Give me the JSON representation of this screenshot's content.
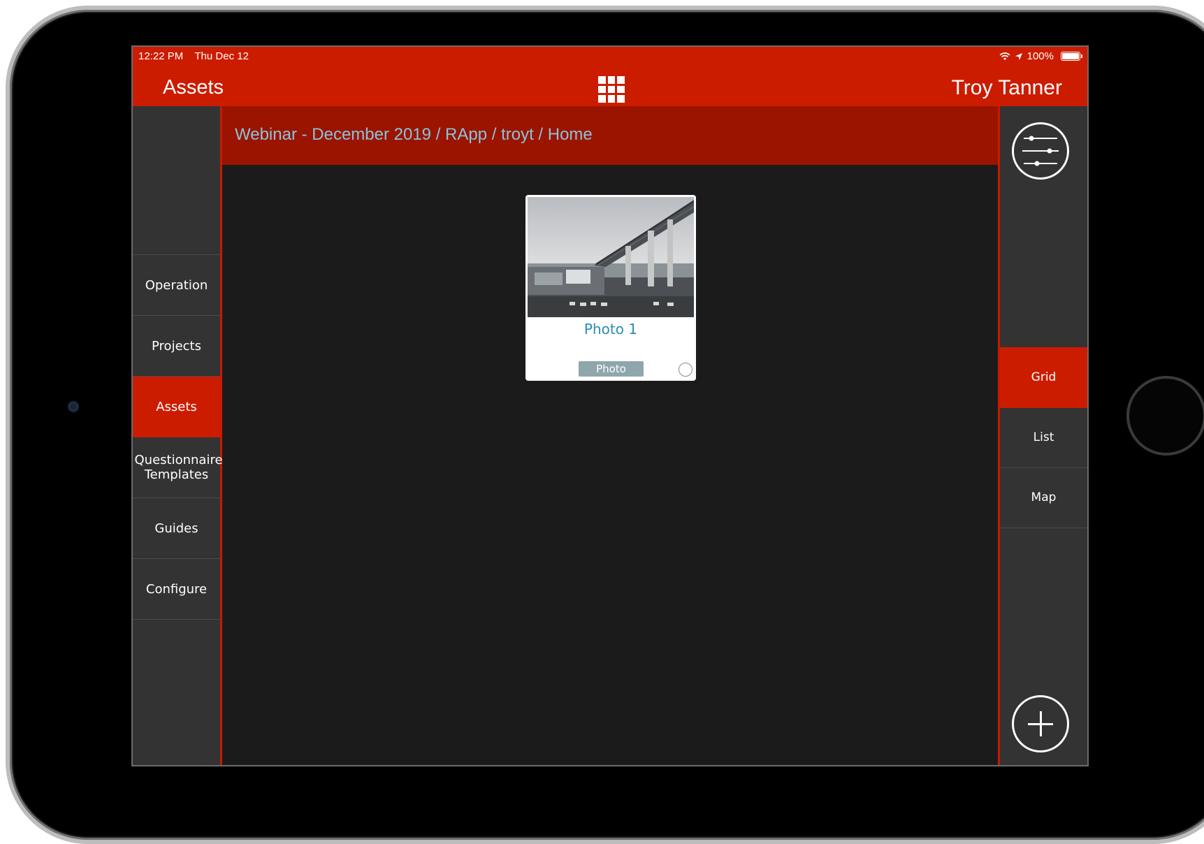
{
  "status_bar": {
    "time": "12:22 PM",
    "date": "Thu Dec 12",
    "battery": "100%",
    "icons": [
      "wifi-icon",
      "location-arrow-icon",
      "battery-icon"
    ]
  },
  "nav": {
    "title": "Assets",
    "center_icon": "grid-icon",
    "user": "Troy Tanner"
  },
  "breadcrumb": "Webinar - December 2019 / RApp / troyt / Home",
  "left_sidebar": {
    "items": [
      {
        "label": "Operation",
        "active": false
      },
      {
        "label": "Projects",
        "active": false
      },
      {
        "label": "Assets",
        "active": true
      },
      {
        "label": "Questionnaire Templates",
        "active": false
      },
      {
        "label": "Guides",
        "active": false
      },
      {
        "label": "Configure",
        "active": false
      }
    ]
  },
  "right_sidebar": {
    "filter_icon": "sliders-icon",
    "views": [
      {
        "label": "Grid",
        "active": true
      },
      {
        "label": "List",
        "active": false
      },
      {
        "label": "Map",
        "active": false
      }
    ],
    "add_icon": "plus-icon"
  },
  "assets": [
    {
      "title": "Photo 1",
      "type": "Photo",
      "selected": false
    }
  ],
  "colors": {
    "primary": "#cc1c00",
    "breadcrumb_bg": "#9a1400",
    "sidebar_bg": "#333333",
    "content_bg": "#1b1b1b",
    "link": "#2b8cb5"
  }
}
